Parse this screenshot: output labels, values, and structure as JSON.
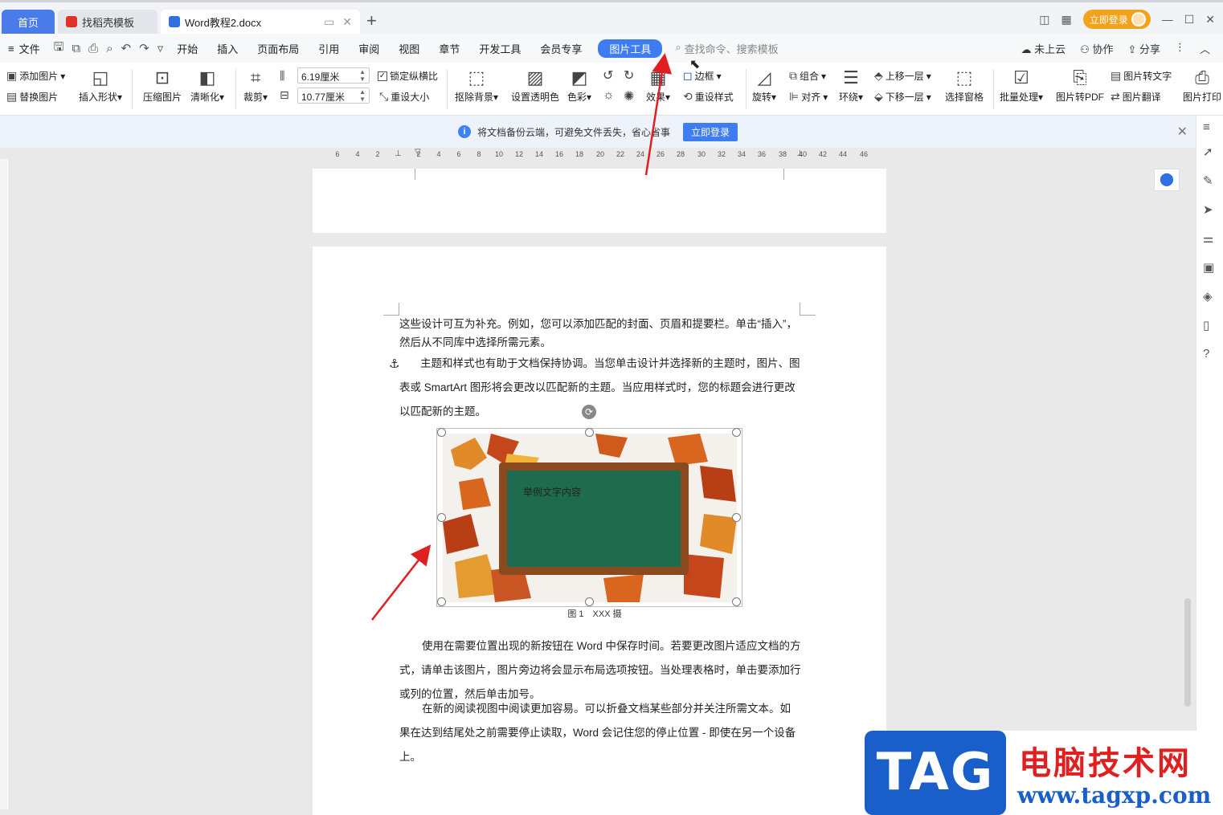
{
  "tabs": {
    "home": "首页",
    "templates": "找稻壳模板",
    "document": "Word教程2.docx",
    "new_tab": "+"
  },
  "titlebar": {
    "login": "立即登录"
  },
  "menu": {
    "file": "文件",
    "items": [
      "开始",
      "插入",
      "页面布局",
      "引用",
      "审阅",
      "视图",
      "章节",
      "开发工具",
      "会员专享"
    ],
    "active_tab": "图片工具",
    "search_placeholder": "查找命令、搜索模板",
    "right": {
      "cloud": "未上云",
      "collab": "协作",
      "share": "分享"
    }
  },
  "ribbon": {
    "add_picture": "添加图片",
    "replace_picture": "替换图片",
    "insert_shape": "插入形状",
    "compress": "压缩图片",
    "sharpen": "清晰化",
    "crop": "裁剪",
    "height_value": "6.19厘米",
    "width_value": "10.77厘米",
    "lock_ratio": "锁定纵横比",
    "reset_size": "重设大小",
    "remove_bg": "抠除背景",
    "transparency": "设置透明色",
    "color": "色彩",
    "effects": "效果",
    "border": "边框",
    "reset_style": "重设样式",
    "rotate": "旋转",
    "group": "组合",
    "align": "对齐",
    "wrap": "环绕",
    "bring_forward": "上移一层",
    "send_backward": "下移一层",
    "selection_pane": "选择窗格",
    "batch": "批量处理",
    "to_pdf": "图片转PDF",
    "to_text": "图片转文字",
    "translate": "图片翻译",
    "print": "图片打印"
  },
  "notification": {
    "text": "将文档备份云端，可避免文件丢失，省心省事",
    "button": "立即登录"
  },
  "ruler": {
    "h_ticks": [
      "6",
      "4",
      "2",
      "2",
      "4",
      "6",
      "8",
      "10",
      "12",
      "14",
      "16",
      "18",
      "20",
      "22",
      "24",
      "26",
      "28",
      "30",
      "32",
      "34",
      "36",
      "38",
      "40",
      "42",
      "44",
      "46"
    ]
  },
  "document": {
    "para1": "这些设计可互为补充。例如，您可以添加匹配的封面、页眉和提要栏。单击“插入”，然后从不同库中选择所需元素。",
    "para2": "主题和样式也有助于文档保持协调。当您单击设计并选择新的主题时，图片、图表或 SmartArt 图形将会更改以匹配新的主题。当应用样式时，您的标题会进行更改以匹配新的主题。",
    "image_text": "举例文字内容",
    "caption": "图 1　XXX 摄",
    "para3": "使用在需要位置出现的新按钮在 Word 中保存时间。若要更改图片适应文档的方式，请单击该图片，图片旁边将会显示布局选项按钮。当处理表格时，单击要添加行或列的位置，然后单击加号。",
    "para4": "在新的阅读视图中阅读更加容易。可以折叠文档某些部分并关注所需文本。如果在达到结尾处之前需要停止读取，Word 会记住您的停止位置 - 即使在另一个设备上。"
  },
  "watermark": {
    "tag": "TAG",
    "title": "电脑技术网",
    "url": "www.tagxp.com"
  },
  "colors": {
    "accent": "#3e7cf2",
    "arrow": "#e02020",
    "chalkboard": "#1f6b4f",
    "frame": "#8b4a1e"
  }
}
